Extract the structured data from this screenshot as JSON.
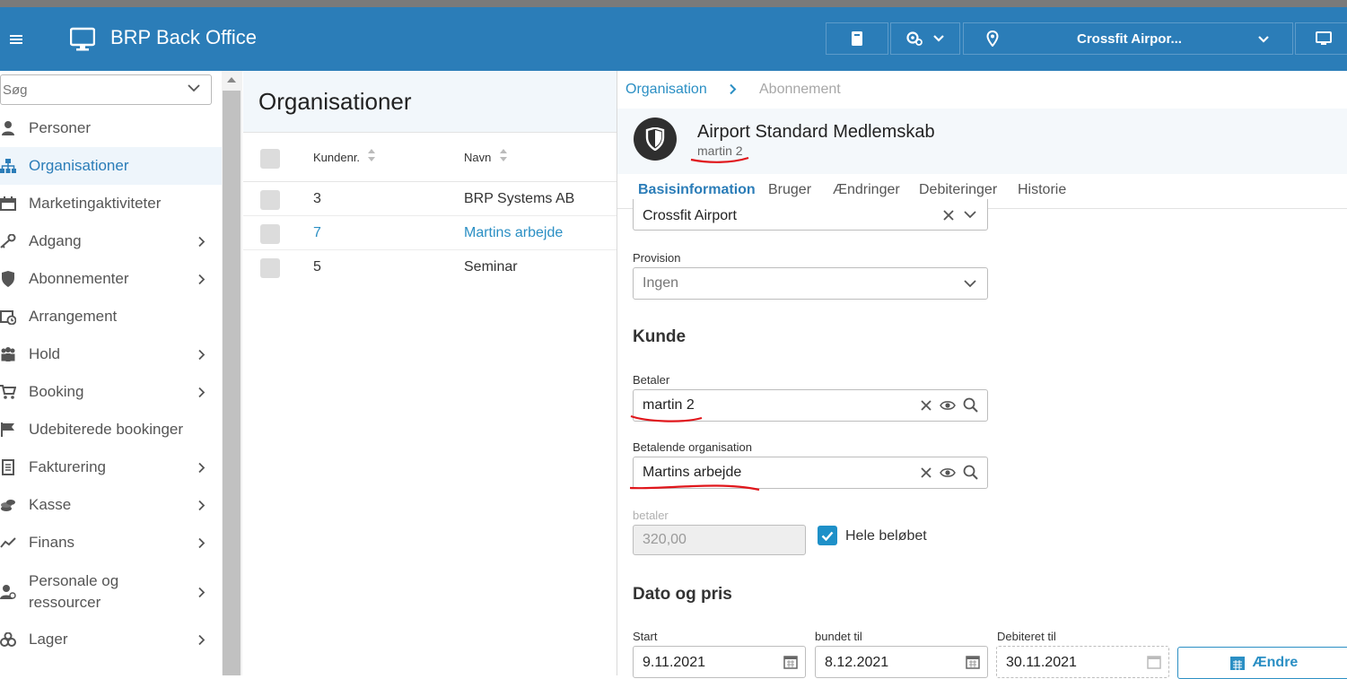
{
  "header": {
    "app_title": "BRP Back Office",
    "club_selector": "Crossfit Airpor..."
  },
  "sidebar": {
    "search_placeholder": "Søg",
    "items": [
      {
        "label": "Personer",
        "icon": "person-icon",
        "chevron": false,
        "active": false
      },
      {
        "label": "Organisationer",
        "icon": "org-tree-icon",
        "chevron": false,
        "active": true
      },
      {
        "label": "Marketingaktiviteter",
        "icon": "calendar-icon",
        "chevron": false,
        "active": false
      },
      {
        "label": "Adgang",
        "icon": "key-icon",
        "chevron": true,
        "active": false
      },
      {
        "label": "Abonnementer",
        "icon": "shield-icon",
        "chevron": true,
        "active": false
      },
      {
        "label": "Arrangement",
        "icon": "event-calendar-icon",
        "chevron": false,
        "active": false
      },
      {
        "label": "Hold",
        "icon": "group-icon",
        "chevron": true,
        "active": false
      },
      {
        "label": "Booking",
        "icon": "cart-icon",
        "chevron": true,
        "active": false
      },
      {
        "label": "Udebiterede bookinger",
        "icon": "flag-icon",
        "chevron": false,
        "active": false
      },
      {
        "label": "Fakturering",
        "icon": "invoice-icon",
        "chevron": true,
        "active": false
      },
      {
        "label": "Kasse",
        "icon": "coins-icon",
        "chevron": true,
        "active": false
      },
      {
        "label": "Finans",
        "icon": "trend-icon",
        "chevron": true,
        "active": false
      },
      {
        "label": "Personale og ressourcer",
        "icon": "staff-icon",
        "chevron": true,
        "active": false
      },
      {
        "label": "Lager",
        "icon": "boxes-icon",
        "chevron": true,
        "active": false
      }
    ]
  },
  "list": {
    "title": "Organisationer",
    "columns": [
      "Kundenr.",
      "Navn"
    ],
    "rows": [
      {
        "kundenr": "3",
        "navn": "BRP Systems AB"
      },
      {
        "kundenr": "7",
        "navn": "Martins arbejde"
      },
      {
        "kundenr": "5",
        "navn": "Seminar"
      }
    ]
  },
  "detail": {
    "breadcrumb": [
      "Organisation",
      "Abonnement"
    ],
    "title": "Airport Standard Medlemskab",
    "subtitle": "martin 2",
    "tabs": [
      "Basisinformation",
      "Bruger",
      "Ændringer",
      "Debiteringer",
      "Historie"
    ],
    "club_value": "Crossfit Airport",
    "provision_label": "Provision",
    "provision_value": "Ingen",
    "kunde_heading": "Kunde",
    "betaler_label": "Betaler",
    "betaler_value": "martin 2",
    "org_label": "Betalende organisation",
    "org_value": "Martins arbejde",
    "amount_label": "betaler",
    "amount_value": "320,00",
    "full_amount_label": "Hele beløbet",
    "full_amount_checked": true,
    "date_heading": "Dato og pris",
    "start_label": "Start",
    "start_value": "9.11.2021",
    "bound_label": "bundet til",
    "bound_value": "8.12.2021",
    "billed_label": "Debiteret til",
    "billed_value": "30.11.2021",
    "edit_label": "Ændre"
  },
  "colors": {
    "brand": "#2b7db8",
    "link": "#2b8fc4",
    "annotation": "#e0161b"
  }
}
